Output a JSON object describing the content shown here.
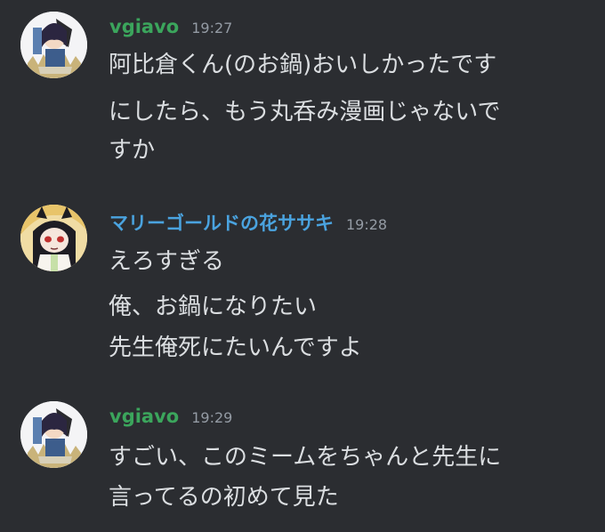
{
  "colors": {
    "background": "#2b2d31",
    "text": "#dbdee1",
    "timestamp": "#949ba4",
    "vgiavo_name": "#3ba55c",
    "marigold_name": "#4aa3df"
  },
  "messages": [
    {
      "username": "vgiavo",
      "timestamp": "19:27",
      "avatar_icon": "vgiavo-avatar-icon",
      "lines": [
        "阿比倉くん(のお鍋)おいしかったです",
        "にしたら、もう丸呑み漫画じゃないで",
        "すか"
      ]
    },
    {
      "username": "マリーゴールドの花ササキ",
      "timestamp": "19:28",
      "avatar_icon": "marigold-avatar-icon",
      "lines": [
        "えろすぎる",
        "俺、お鍋になりたい",
        "先生俺死にたいんですよ"
      ]
    },
    {
      "username": "vgiavo",
      "timestamp": "19:29",
      "avatar_icon": "vgiavo-avatar-icon",
      "lines": [
        "すごい、このミームをちゃんと先生に",
        "言ってるの初めて見た"
      ]
    }
  ]
}
